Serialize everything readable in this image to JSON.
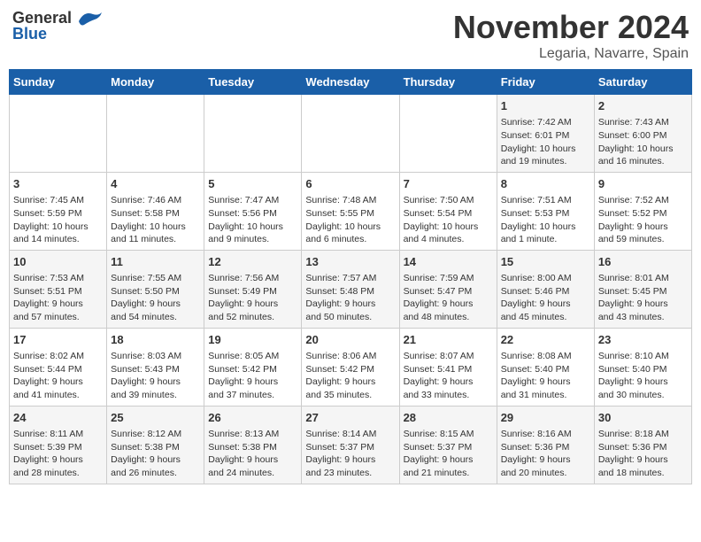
{
  "header": {
    "logo_general": "General",
    "logo_blue": "Blue",
    "month": "November 2024",
    "location": "Legaria, Navarre, Spain"
  },
  "days_of_week": [
    "Sunday",
    "Monday",
    "Tuesday",
    "Wednesday",
    "Thursday",
    "Friday",
    "Saturday"
  ],
  "weeks": [
    [
      {
        "day": "",
        "info": ""
      },
      {
        "day": "",
        "info": ""
      },
      {
        "day": "",
        "info": ""
      },
      {
        "day": "",
        "info": ""
      },
      {
        "day": "",
        "info": ""
      },
      {
        "day": "1",
        "info": "Sunrise: 7:42 AM\nSunset: 6:01 PM\nDaylight: 10 hours\nand 19 minutes."
      },
      {
        "day": "2",
        "info": "Sunrise: 7:43 AM\nSunset: 6:00 PM\nDaylight: 10 hours\nand 16 minutes."
      }
    ],
    [
      {
        "day": "3",
        "info": "Sunrise: 7:45 AM\nSunset: 5:59 PM\nDaylight: 10 hours\nand 14 minutes."
      },
      {
        "day": "4",
        "info": "Sunrise: 7:46 AM\nSunset: 5:58 PM\nDaylight: 10 hours\nand 11 minutes."
      },
      {
        "day": "5",
        "info": "Sunrise: 7:47 AM\nSunset: 5:56 PM\nDaylight: 10 hours\nand 9 minutes."
      },
      {
        "day": "6",
        "info": "Sunrise: 7:48 AM\nSunset: 5:55 PM\nDaylight: 10 hours\nand 6 minutes."
      },
      {
        "day": "7",
        "info": "Sunrise: 7:50 AM\nSunset: 5:54 PM\nDaylight: 10 hours\nand 4 minutes."
      },
      {
        "day": "8",
        "info": "Sunrise: 7:51 AM\nSunset: 5:53 PM\nDaylight: 10 hours\nand 1 minute."
      },
      {
        "day": "9",
        "info": "Sunrise: 7:52 AM\nSunset: 5:52 PM\nDaylight: 9 hours\nand 59 minutes."
      }
    ],
    [
      {
        "day": "10",
        "info": "Sunrise: 7:53 AM\nSunset: 5:51 PM\nDaylight: 9 hours\nand 57 minutes."
      },
      {
        "day": "11",
        "info": "Sunrise: 7:55 AM\nSunset: 5:50 PM\nDaylight: 9 hours\nand 54 minutes."
      },
      {
        "day": "12",
        "info": "Sunrise: 7:56 AM\nSunset: 5:49 PM\nDaylight: 9 hours\nand 52 minutes."
      },
      {
        "day": "13",
        "info": "Sunrise: 7:57 AM\nSunset: 5:48 PM\nDaylight: 9 hours\nand 50 minutes."
      },
      {
        "day": "14",
        "info": "Sunrise: 7:59 AM\nSunset: 5:47 PM\nDaylight: 9 hours\nand 48 minutes."
      },
      {
        "day": "15",
        "info": "Sunrise: 8:00 AM\nSunset: 5:46 PM\nDaylight: 9 hours\nand 45 minutes."
      },
      {
        "day": "16",
        "info": "Sunrise: 8:01 AM\nSunset: 5:45 PM\nDaylight: 9 hours\nand 43 minutes."
      }
    ],
    [
      {
        "day": "17",
        "info": "Sunrise: 8:02 AM\nSunset: 5:44 PM\nDaylight: 9 hours\nand 41 minutes."
      },
      {
        "day": "18",
        "info": "Sunrise: 8:03 AM\nSunset: 5:43 PM\nDaylight: 9 hours\nand 39 minutes."
      },
      {
        "day": "19",
        "info": "Sunrise: 8:05 AM\nSunset: 5:42 PM\nDaylight: 9 hours\nand 37 minutes."
      },
      {
        "day": "20",
        "info": "Sunrise: 8:06 AM\nSunset: 5:42 PM\nDaylight: 9 hours\nand 35 minutes."
      },
      {
        "day": "21",
        "info": "Sunrise: 8:07 AM\nSunset: 5:41 PM\nDaylight: 9 hours\nand 33 minutes."
      },
      {
        "day": "22",
        "info": "Sunrise: 8:08 AM\nSunset: 5:40 PM\nDaylight: 9 hours\nand 31 minutes."
      },
      {
        "day": "23",
        "info": "Sunrise: 8:10 AM\nSunset: 5:40 PM\nDaylight: 9 hours\nand 30 minutes."
      }
    ],
    [
      {
        "day": "24",
        "info": "Sunrise: 8:11 AM\nSunset: 5:39 PM\nDaylight: 9 hours\nand 28 minutes."
      },
      {
        "day": "25",
        "info": "Sunrise: 8:12 AM\nSunset: 5:38 PM\nDaylight: 9 hours\nand 26 minutes."
      },
      {
        "day": "26",
        "info": "Sunrise: 8:13 AM\nSunset: 5:38 PM\nDaylight: 9 hours\nand 24 minutes."
      },
      {
        "day": "27",
        "info": "Sunrise: 8:14 AM\nSunset: 5:37 PM\nDaylight: 9 hours\nand 23 minutes."
      },
      {
        "day": "28",
        "info": "Sunrise: 8:15 AM\nSunset: 5:37 PM\nDaylight: 9 hours\nand 21 minutes."
      },
      {
        "day": "29",
        "info": "Sunrise: 8:16 AM\nSunset: 5:36 PM\nDaylight: 9 hours\nand 20 minutes."
      },
      {
        "day": "30",
        "info": "Sunrise: 8:18 AM\nSunset: 5:36 PM\nDaylight: 9 hours\nand 18 minutes."
      }
    ]
  ]
}
